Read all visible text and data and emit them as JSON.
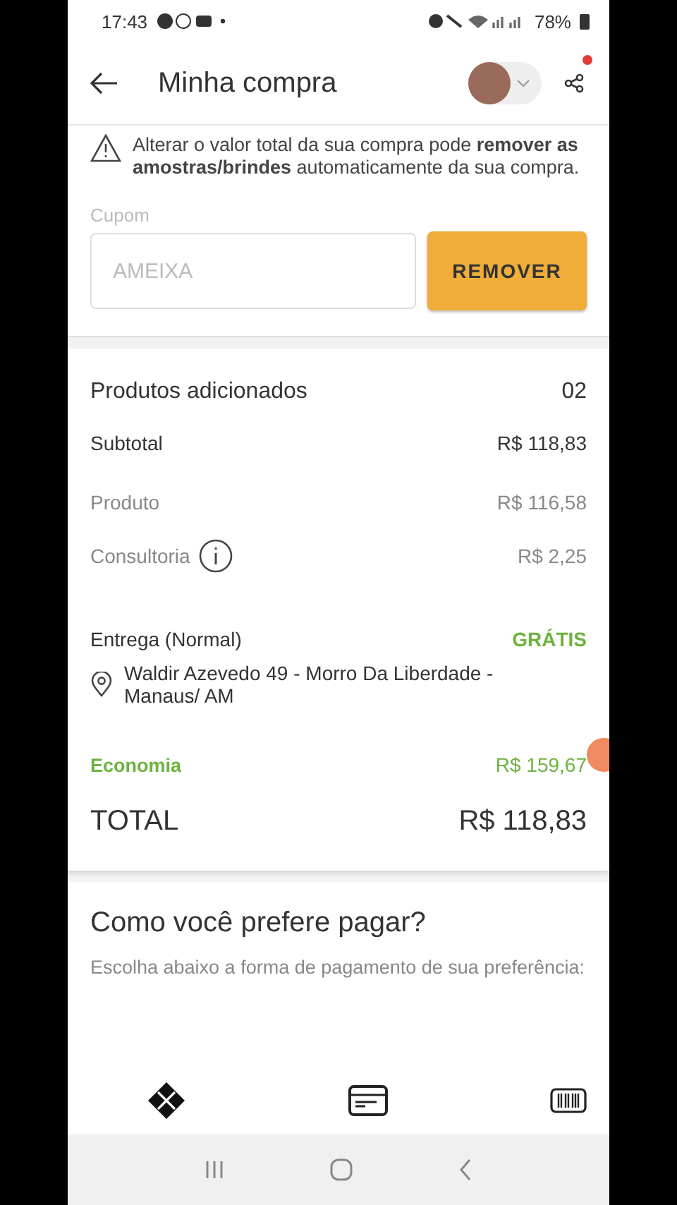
{
  "status_bar": {
    "time": "17:43",
    "battery": "78%"
  },
  "header": {
    "title": "Minha compra",
    "notification": true
  },
  "warning": {
    "text": "Alterar o valor total da sua compra pode **remover as amostras/brindes** automaticamente da sua compra."
  },
  "coupon": {
    "label": "Cupom",
    "placeholder": "AMEIXA",
    "button": "REMOVER"
  },
  "summary": {
    "title": "Produtos adicionados",
    "count": "02",
    "rows": [
      {
        "kind": "main",
        "label": "Subtotal",
        "value": "R$ 118,83"
      },
      {
        "kind": "sub",
        "label": "Produto",
        "value": "R$ 116,58"
      },
      {
        "kind": "sub",
        "label": "Consultoria",
        "value": "R$ 2,25",
        "info": true
      }
    ],
    "delivery": {
      "label": "Entrega (Normal)",
      "value": "GRÁTIS",
      "address": "Waldir Azevedo 49 - Morro Da Liberdade - Manaus/ AM"
    },
    "savings": {
      "label": "Economia",
      "value": "R$ 159,67"
    },
    "total": {
      "label": "TOTAL",
      "value": "R$ 118,83"
    }
  },
  "payment": {
    "title": "Como você prefere pagar?",
    "subtitle": "Escolha abaixo a forma de pagamento de sua preferência:",
    "methods": [
      {
        "kind": "pix"
      },
      {
        "kind": "card"
      },
      {
        "kind": "boleto"
      }
    ]
  }
}
